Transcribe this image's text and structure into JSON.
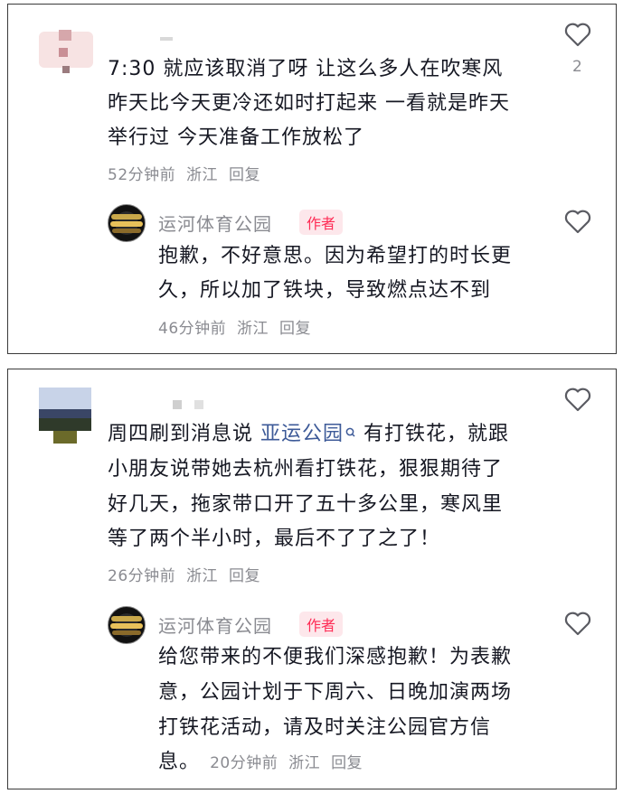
{
  "comments": [
    {
      "text_lines": [
        "7:30 就应该取消了呀 让这么多人在吹寒风",
        "昨天比今天更冷还如时打起来 一看就是昨天",
        "举行过 今天准备工作放松了"
      ],
      "time": "52分钟前",
      "location": "浙江",
      "reply_label": "回复",
      "like_count": "2",
      "reply": {
        "author": "运河体育公园",
        "badge": "作者",
        "text_lines": [
          "抱歉，不好意思。因为希望打的时长更",
          "久，所以加了铁块，导致燃点达不到"
        ],
        "time": "46分钟前",
        "location": "浙江",
        "reply_label": "回复"
      }
    },
    {
      "text_line1_before": "周四刷到消息说 ",
      "hashtag": "亚运公园",
      "text_line1_after": " 有打铁花，就跟",
      "text_lines": [
        "小朋友说带她去杭州看打铁花，狠狠期待了",
        "好几天，拖家带口开了五十多公里，寒风里",
        "等了两个半小时，最后不了了之了！"
      ],
      "time": "26分钟前",
      "location": "浙江",
      "reply_label": "回复",
      "reply": {
        "author": "运河体育公园",
        "badge": "作者",
        "text_lines": [
          "给您带来的不便我们深感抱歉！为表歉",
          "意，公园计划于下周六、日晚加演两场",
          "打铁花活动，请及时关注公园官方信"
        ],
        "last_line": "息。",
        "time": "20分钟前",
        "location": "浙江",
        "reply_label": "回复"
      }
    }
  ],
  "icons": {
    "like": "heart-outline-icon",
    "search": "search-icon"
  }
}
